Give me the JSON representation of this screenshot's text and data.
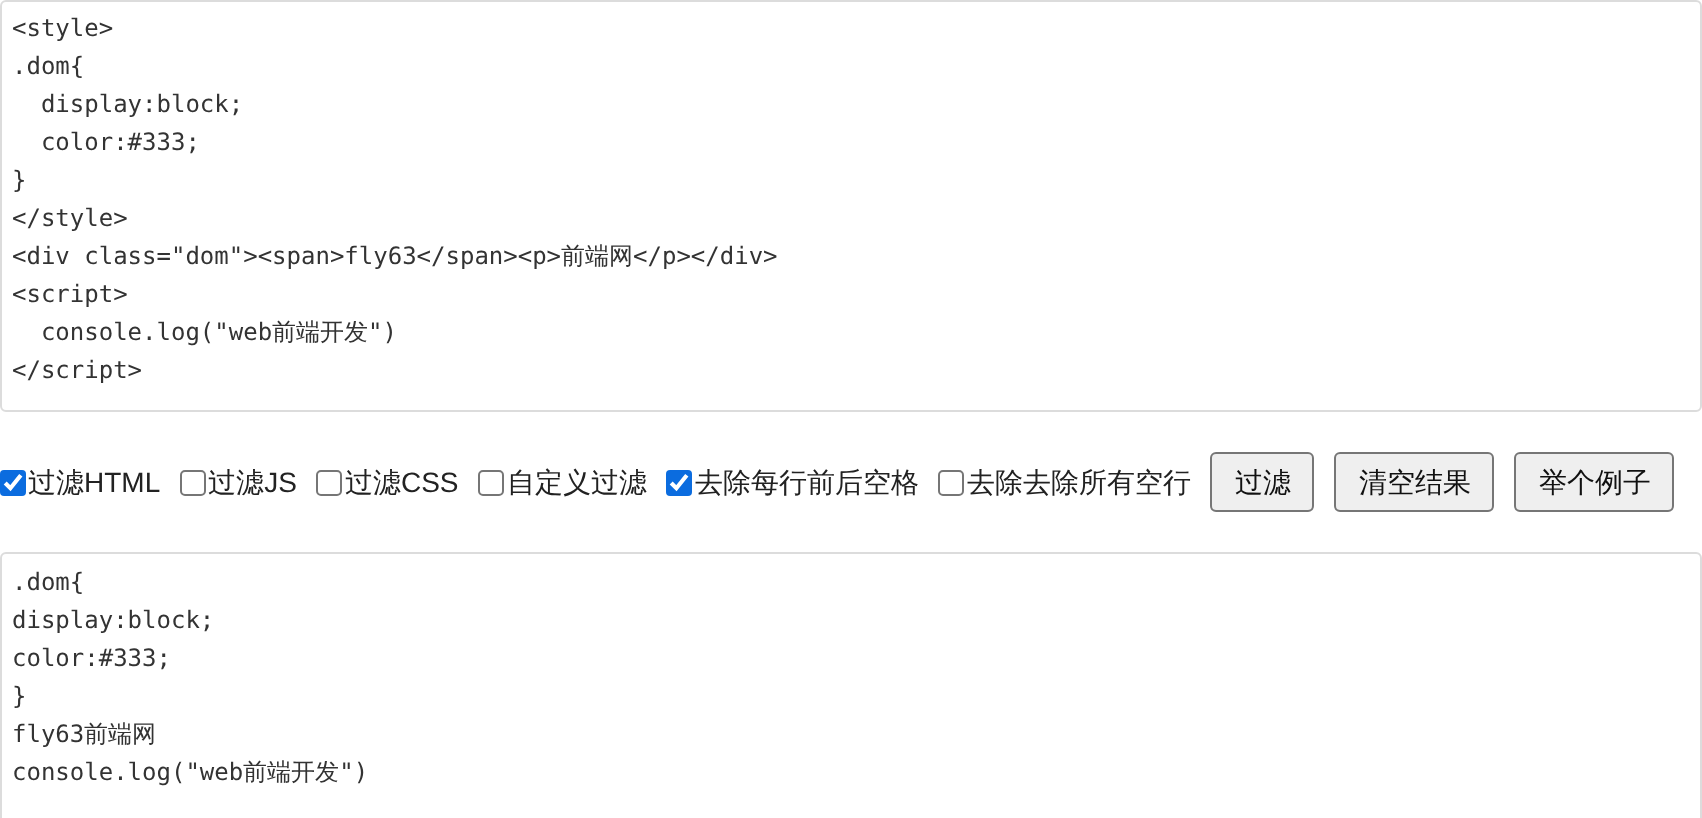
{
  "input_lines": [
    "<style>",
    ".dom{",
    "  display:block;",
    "  color:#333;",
    "}",
    "</style>",
    "<div class=\"dom\"><span>fly63</span><p>前端网</p></div>",
    "<script>",
    "  console.log(\"web前端开发\")",
    "</script>"
  ],
  "options": [
    {
      "label": "过滤HTML",
      "checked": true
    },
    {
      "label": "过滤JS",
      "checked": false
    },
    {
      "label": "过滤CSS",
      "checked": false
    },
    {
      "label": "自定义过滤",
      "checked": false
    },
    {
      "label": "去除每行前后空格",
      "checked": true
    },
    {
      "label": "去除去除所有空行",
      "checked": false
    }
  ],
  "buttons": [
    "过滤",
    "清空结果",
    "举个例子"
  ],
  "output_lines": [
    ".dom{",
    "display:block;",
    "color:#333;",
    "}",
    "fly63前端网",
    "console.log(\"web前端开发\")"
  ]
}
